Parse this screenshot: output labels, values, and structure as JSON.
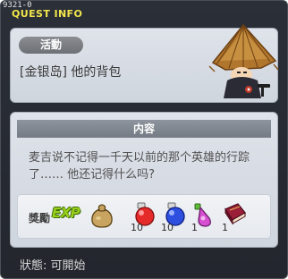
{
  "window": {
    "quest_id": "9321-0",
    "title": "QUEST INFO"
  },
  "quest": {
    "category": "活動",
    "name": "[金银岛] 他的背包"
  },
  "content": {
    "header": "内容",
    "description": "麦吉说不记得一千天以前的那个英雄的行踪了…… 他还记得什么吗?"
  },
  "rewards": {
    "label": "獎勵",
    "exp_label": "EXP",
    "items": [
      {
        "icon": "meso-bag-icon",
        "count": ""
      },
      {
        "icon": "red-potion-icon",
        "count": "10"
      },
      {
        "icon": "blue-potion-icon",
        "count": "10"
      },
      {
        "icon": "elixir-potion-icon",
        "count": "1"
      },
      {
        "icon": "book-icon",
        "count": "1"
      }
    ]
  },
  "status": {
    "text": "狀態:  可開始"
  },
  "colors": {
    "title": "#f2e64c",
    "panel": "#d8dde5",
    "exp": "#98cf1a"
  }
}
